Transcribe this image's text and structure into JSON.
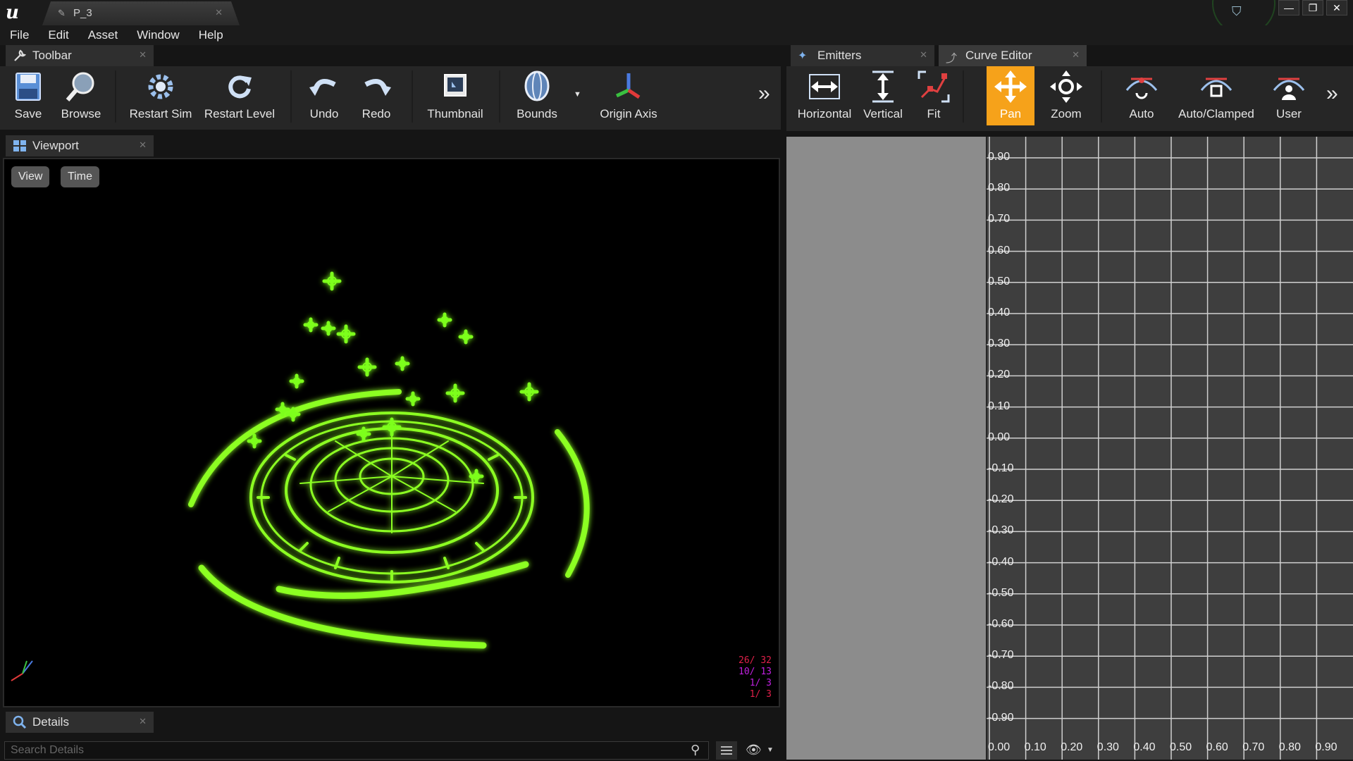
{
  "window": {
    "tab_title": "P_3",
    "controls": [
      "—",
      "❐",
      "✕"
    ]
  },
  "menu": [
    "File",
    "Edit",
    "Asset",
    "Window",
    "Help"
  ],
  "toolbar_panel": {
    "title": "Toolbar",
    "tools": [
      {
        "label": "Save",
        "icon": "save-icon"
      },
      {
        "label": "Browse",
        "icon": "browse-icon"
      },
      {
        "label": "Restart Sim",
        "icon": "restart-sim-icon"
      },
      {
        "label": "Restart Level",
        "icon": "restart-level-icon"
      },
      {
        "label": "Undo",
        "icon": "undo-icon"
      },
      {
        "label": "Redo",
        "icon": "redo-icon"
      },
      {
        "label": "Thumbnail",
        "icon": "thumbnail-icon"
      },
      {
        "label": "Bounds",
        "icon": "bounds-icon"
      },
      {
        "label": "Origin Axis",
        "icon": "origin-axis-icon"
      }
    ]
  },
  "viewport_panel": {
    "title": "Viewport",
    "view_label": "View",
    "time_label": "Time",
    "stats": [
      {
        "text": "26/ 32",
        "color": "#e0204a"
      },
      {
        "text": "10/ 13",
        "color": "#c020e0"
      },
      {
        "text": "1/ 3",
        "color": "#c020e0"
      },
      {
        "text": "1/ 3",
        "color": "#e0204a"
      }
    ],
    "effect_color": "#7dff1a"
  },
  "details_panel": {
    "title": "Details",
    "search_placeholder": "Search Details"
  },
  "emitters_tab": {
    "title": "Emitters"
  },
  "curve_editor": {
    "title": "Curve Editor",
    "tools": [
      {
        "label": "Horizontal",
        "icon": "fit-horizontal-icon",
        "active": false
      },
      {
        "label": "Vertical",
        "icon": "fit-vertical-icon",
        "active": false
      },
      {
        "label": "Fit",
        "icon": "fit-icon",
        "active": false
      },
      {
        "label": "Pan",
        "icon": "pan-icon",
        "active": true
      },
      {
        "label": "Zoom",
        "icon": "zoom-icon",
        "active": false
      },
      {
        "label": "Auto",
        "icon": "auto-tangent-icon",
        "active": false
      },
      {
        "label": "Auto/Clamped",
        "icon": "auto-clamped-tangent-icon",
        "active": false
      },
      {
        "label": "User",
        "icon": "user-tangent-icon",
        "active": false
      }
    ],
    "y_labels": [
      "0.90",
      "0.80",
      "0.70",
      "0.60",
      "0.50",
      "0.40",
      "0.30",
      "0.20",
      "0.10",
      "0.00",
      "-0.10",
      "-0.20",
      "-0.30",
      "-0.40",
      "-0.50",
      "-0.60",
      "-0.70",
      "-0.80",
      "-0.90"
    ],
    "x_labels": [
      "0.00",
      "0.10",
      "0.20",
      "0.30",
      "0.40",
      "0.50",
      "0.60",
      "0.70",
      "0.80",
      "0.90"
    ],
    "accent": "#f6a21a"
  }
}
